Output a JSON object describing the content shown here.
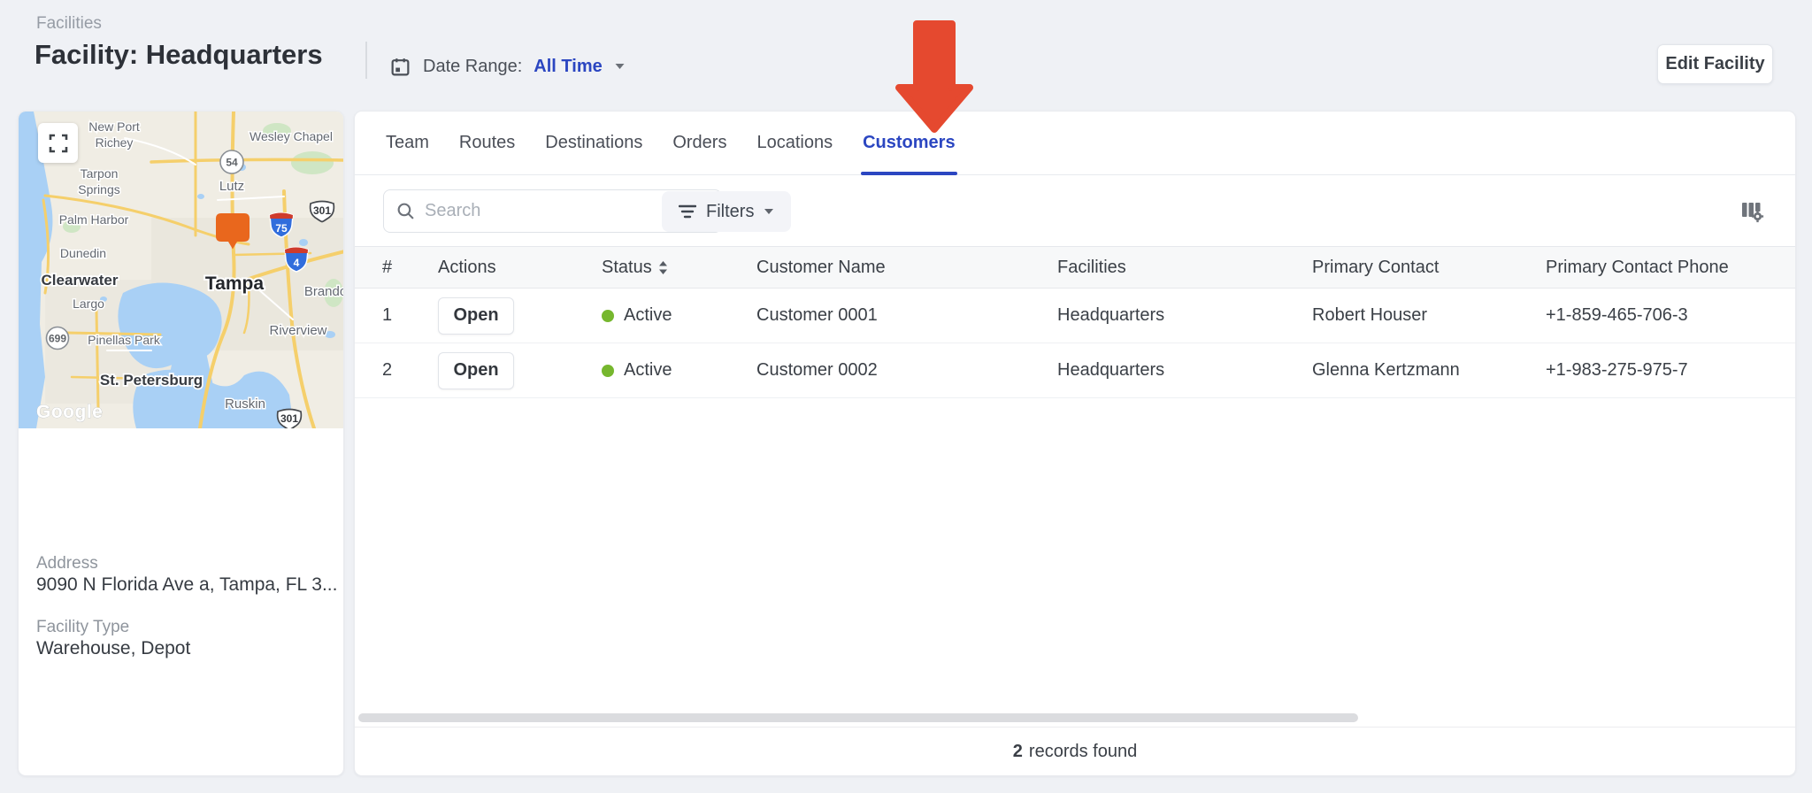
{
  "breadcrumb": "Facilities",
  "page_title": "Facility: Headquarters",
  "date_range": {
    "label": "Date Range:",
    "value": "All Time"
  },
  "edit_button": "Edit Facility",
  "tabs": [
    {
      "label": "Team"
    },
    {
      "label": "Routes"
    },
    {
      "label": "Destinations"
    },
    {
      "label": "Orders"
    },
    {
      "label": "Locations"
    },
    {
      "label": "Customers"
    }
  ],
  "active_tab": "Customers",
  "toolbar": {
    "search_placeholder": "Search",
    "filters_label": "Filters"
  },
  "table": {
    "columns": [
      "#",
      "Actions",
      "Status",
      "Customer Name",
      "Facilities",
      "Primary Contact",
      "Primary Contact Phone"
    ],
    "rows": [
      {
        "index": "1",
        "action": "Open",
        "status": "Active",
        "customer_name": "Customer 0001",
        "facilities": "Headquarters",
        "primary_contact": "Robert Houser",
        "primary_contact_phone": "+1-859-465-706-3"
      },
      {
        "index": "2",
        "action": "Open",
        "status": "Active",
        "customer_name": "Customer 0002",
        "facilities": "Headquarters",
        "primary_contact": "Glenna Kertzmann",
        "primary_contact_phone": "+1-983-275-975-7"
      }
    ]
  },
  "footer": {
    "count": "2",
    "label": "records found"
  },
  "facility_info": {
    "address_label": "Address",
    "address_value": "9090 N Florida Ave a, Tampa, FL 3...",
    "type_label": "Facility Type",
    "type_value": "Warehouse, Depot"
  },
  "map": {
    "attribution": "Google",
    "labels": {
      "new_port": "New Port",
      "richey": "Richey",
      "wesley_chapel": "Wesley Chapel",
      "tarpon": "Tarpon",
      "springs": "Springs",
      "lutz": "Lutz",
      "palm_harbor": "Palm Harbor",
      "dunedin": "Dunedin",
      "clearwater": "Clearwater",
      "largo": "Largo",
      "pinellas_park": "Pinellas Park",
      "st_petersburg": "St. Petersburg",
      "tampa": "Tampa",
      "brandon": "Brando",
      "riverview": "Riverview",
      "ruskin": "Ruskin"
    },
    "shields": {
      "sr54": "54",
      "sr699": "699",
      "us301_north": "301",
      "us301_south": "301",
      "i75": "75",
      "i4": "4"
    }
  },
  "colors": {
    "accent_blue": "#2b46c1",
    "status_green": "#76b72e",
    "arrow_red": "#e5492f",
    "marker_orange": "#e9671d"
  }
}
